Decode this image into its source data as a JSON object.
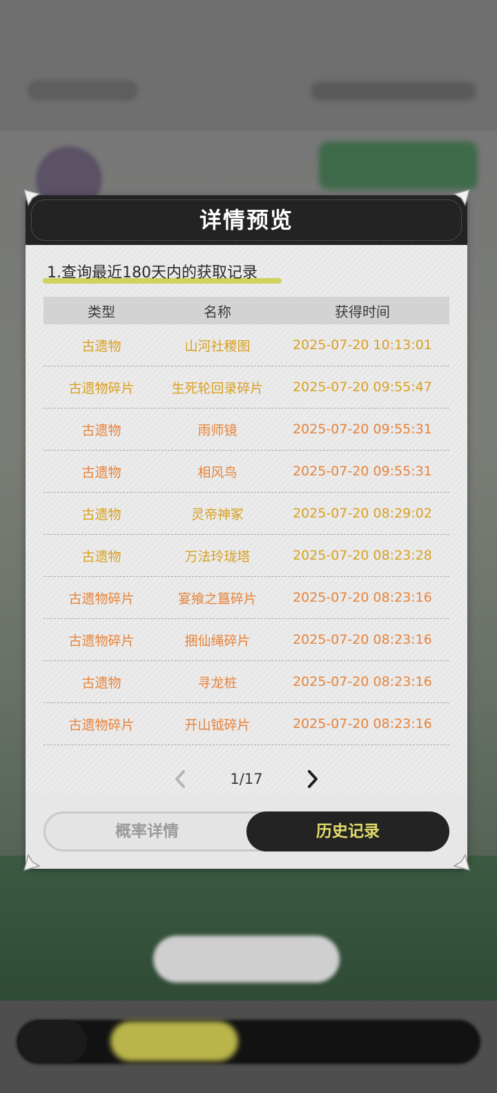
{
  "dialog": {
    "title": "详情预览",
    "query_note": "1.查询最近180天内的获取记录"
  },
  "table": {
    "headers": [
      "类型",
      "名称",
      "获得时间"
    ],
    "rows": [
      {
        "type": "古遗物",
        "name": "山河社稷图",
        "time": "2025-07-20 10:13:01",
        "color": "#d9a020"
      },
      {
        "type": "古遗物碎片",
        "name": "生死轮回录碎片",
        "time": "2025-07-20 09:55:47",
        "color": "#d9a020"
      },
      {
        "type": "古遗物",
        "name": "雨师镜",
        "time": "2025-07-20 09:55:31",
        "color": "#e7833a"
      },
      {
        "type": "古遗物",
        "name": "相风鸟",
        "time": "2025-07-20 09:55:31",
        "color": "#e7833a"
      },
      {
        "type": "古遗物",
        "name": "灵帝神冢",
        "time": "2025-07-20 08:29:02",
        "color": "#d9a020"
      },
      {
        "type": "古遗物",
        "name": "万法玲珑塔",
        "time": "2025-07-20 08:23:28",
        "color": "#d9a020"
      },
      {
        "type": "古遗物碎片",
        "name": "宴飨之簋碎片",
        "time": "2025-07-20 08:23:16",
        "color": "#e7833a"
      },
      {
        "type": "古遗物碎片",
        "name": "捆仙绳碎片",
        "time": "2025-07-20 08:23:16",
        "color": "#e7833a"
      },
      {
        "type": "古遗物",
        "name": "寻龙桩",
        "time": "2025-07-20 08:23:16",
        "color": "#e7833a"
      },
      {
        "type": "古遗物碎片",
        "name": "开山钺碎片",
        "time": "2025-07-20 08:23:16",
        "color": "#e7833a"
      }
    ]
  },
  "pager": {
    "text": "1/17",
    "prev_icon": "chevron-left-icon",
    "next_icon": "chevron-right-icon"
  },
  "tabs": {
    "probability_label": "概率详情",
    "history_label": "历史记录",
    "active": "history"
  },
  "colors": {
    "header_bg": "#232323",
    "highlight_yellow": "#cfd35e",
    "rarity_gold": "#d9a020",
    "rarity_orange": "#e7833a",
    "active_tab_text": "#e3dc6b"
  }
}
